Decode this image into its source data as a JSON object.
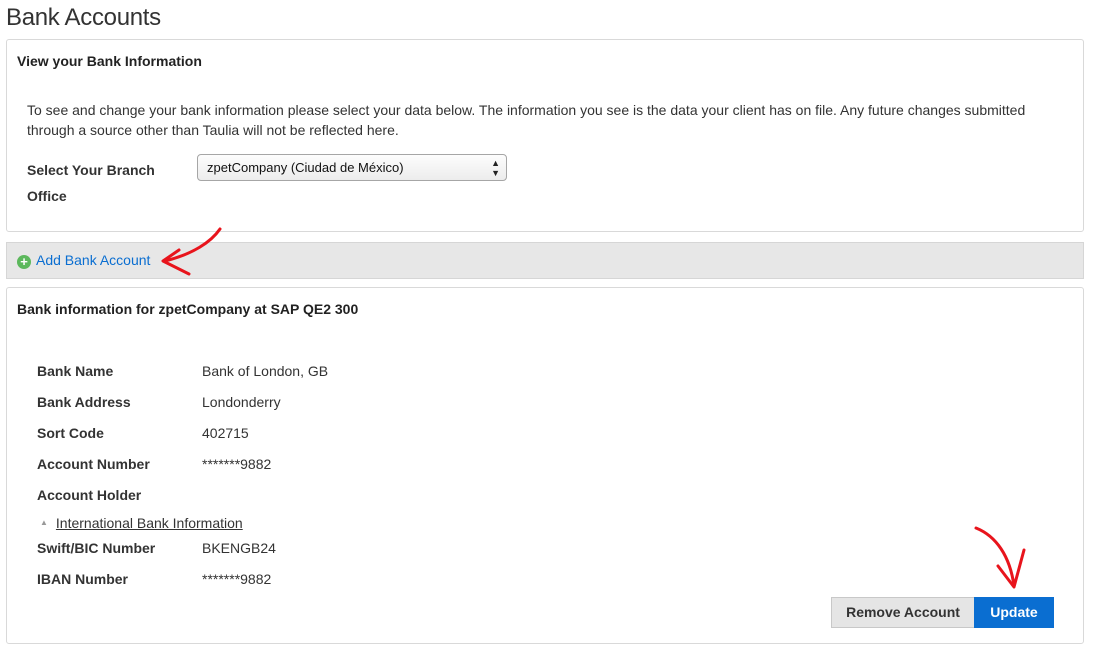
{
  "page": {
    "title": "Bank Accounts"
  },
  "view_panel": {
    "heading": "View your Bank Information",
    "intro": "To see and change your bank information please select your data below. The information you see is the data your client has on file. Any future changes submitted through a source other than Taulia will not be reflected here.",
    "branch_label": "Select Your Branch Office",
    "branch_selected": "zpetCompany (Ciudad de México)"
  },
  "add_bar": {
    "label": "Add Bank Account",
    "icon": "plus-circle-icon"
  },
  "info_panel": {
    "heading": "Bank information for zpetCompany at SAP QE2 300",
    "fields": [
      {
        "label": "Bank Name",
        "value": "Bank of London, GB"
      },
      {
        "label": "Bank Address",
        "value": "Londonderry"
      },
      {
        "label": "Sort Code",
        "value": "402715"
      },
      {
        "label": "Account Number",
        "value": "*******9882"
      },
      {
        "label": "Account Holder",
        "value": ""
      }
    ],
    "international_link": "International Bank Information",
    "international_fields": [
      {
        "label": "Swift/BIC Number",
        "value": "BKENGB24"
      },
      {
        "label": "IBAN Number",
        "value": "*******9882"
      }
    ],
    "remove_label": "Remove Account",
    "update_label": "Update"
  },
  "colors": {
    "accent": "#0a6ed1",
    "add_icon": "#5cb85c",
    "annotation_arrow": "#e8141c"
  }
}
